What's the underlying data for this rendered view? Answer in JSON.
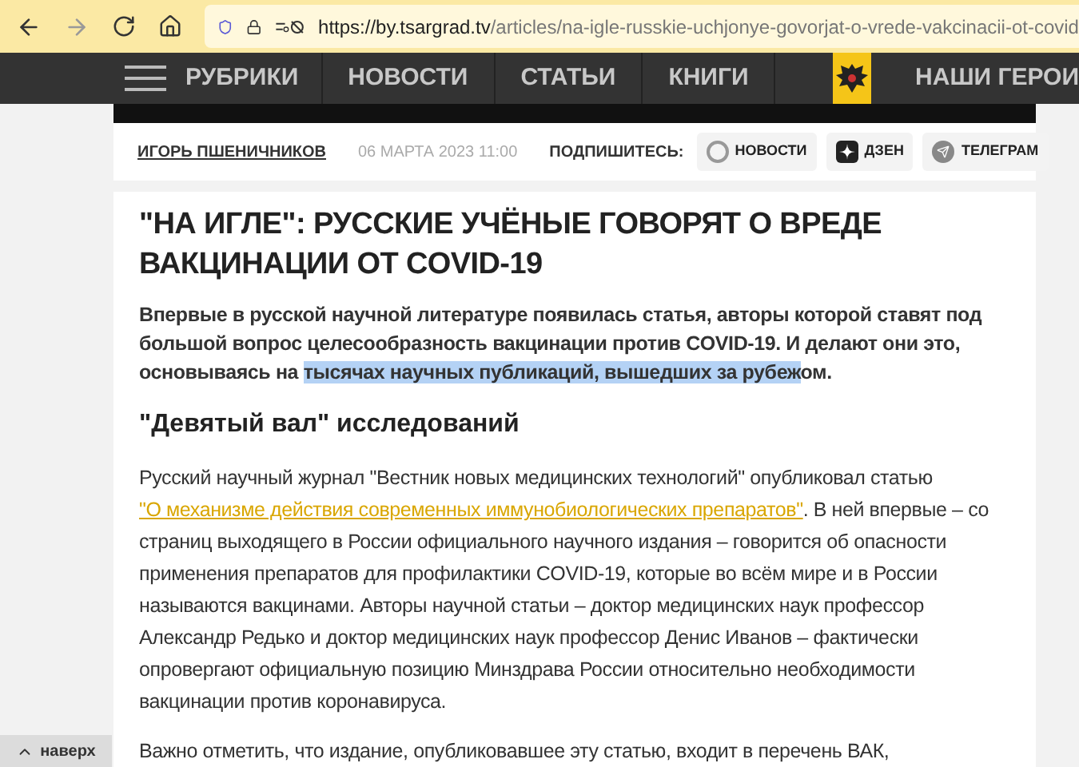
{
  "browser": {
    "url_host": "https://by.tsargrad.tv",
    "url_path": "/articles/na-igle-russkie-uchjonye-govorjat-o-vrede-vakcinacii-ot-covid"
  },
  "nav": {
    "items": [
      {
        "label": "РУБРИКИ"
      },
      {
        "label": "НОВОСТИ"
      },
      {
        "label": "СТАТЬИ"
      },
      {
        "label": "КНИГИ"
      },
      {
        "label": "НАШИ ГЕРОИ"
      }
    ]
  },
  "meta": {
    "author": "ИГОРЬ ПШЕНИЧНИКОВ",
    "date": "06 МАРТА 2023 11:00",
    "subscribe_label": "ПОДПИШИТЕСЬ:",
    "subscribe": [
      {
        "kind": "news",
        "label": "НОВОСТИ"
      },
      {
        "kind": "dzen",
        "label": "ДЗЕН"
      },
      {
        "kind": "telegram",
        "label": "ТЕЛЕГРАМ"
      }
    ]
  },
  "article": {
    "title": "\"НА ИГЛЕ\": РУССКИЕ УЧЁНЫЕ ГОВОРЯТ О ВРЕДЕ ВАКЦИНАЦИИ ОТ COVID-19",
    "lead": [
      {
        "text": "Впервые в русской научной литературе появилась статья, авторы которой ставят под большой вопрос целесообразность вакцинации против COVID-19. И делают они это, основываясь на ",
        "selected": false
      },
      {
        "text": "тысячах научных публикаций, вышедших за рубеж",
        "selected": true
      },
      {
        "text": "ом.",
        "selected": false
      }
    ],
    "heading": "\"Девятый вал\" исследований",
    "paragraphs": [
      [
        {
          "kind": "text",
          "text": "Русский научный журнал \"Вестник новых медицинских технологий\" опубликовал статью "
        },
        {
          "kind": "link",
          "text": "\"О механизме действия современных иммунобиологических препаратов\""
        },
        {
          "kind": "text",
          "text": ". В ней впервые – со страниц выходящего в России официального научного издания – говорится об опасности применения препаратов для профилактики COVID-19, которые во всём мире и в России называются вакцинами. Авторы научной статьи – доктор медицинских наук профессор Александр Редько и доктор медицинских наук профессор Денис Иванов – фактически опровергают официальную позицию Минздрава России относительно необходимости вакцинации против коронавируса."
        }
      ],
      [
        {
          "kind": "text",
          "text": "Важно отметить, что издание, опубликовавшее эту статью, входит в перечень ВАК,"
        }
      ]
    ]
  },
  "back_to_top": "наверх"
}
